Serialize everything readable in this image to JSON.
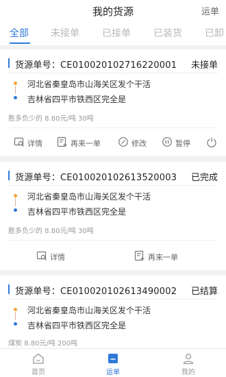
{
  "header": {
    "title": "我的货源",
    "right_action": "运单"
  },
  "tabs": [
    {
      "label": "全部",
      "active": true
    },
    {
      "label": "未接单"
    },
    {
      "label": "已接单"
    },
    {
      "label": "已装货"
    },
    {
      "label": "已卸"
    }
  ],
  "cards": [
    {
      "no": "货源单号：CE010020102716220001",
      "status": "未接单",
      "from": "河北省秦皇岛市山海关区发个干活",
      "to": "吉林省四平市铁西区完全是",
      "meta": "胜多负少的  8.80元/吨  30吨",
      "actions": [
        "详情",
        "再来一单",
        "修改",
        "暂停"
      ]
    },
    {
      "no": "货源单号：CE010020102613520003",
      "status": "已完成",
      "from": "河北省秦皇岛市山海关区发个干活",
      "to": "吉林省四平市铁西区完全是",
      "meta": "胜多负少的  8.80元/吨  30吨",
      "actions": [
        "详情",
        "再来一单"
      ]
    },
    {
      "no": "货源单号：CE010020102613490002",
      "status": "已结算",
      "from": "河北省秦皇岛市山海关区发个干活",
      "to": "吉林省四平市铁西区完全是",
      "meta": "煤炭  8.80元/吨  200吨"
    }
  ],
  "bottom_nav": [
    {
      "label": "首页",
      "icon": "home-icon"
    },
    {
      "label": "运单",
      "icon": "waybill-icon",
      "active": true
    },
    {
      "label": "我的",
      "icon": "profile-icon"
    }
  ],
  "colors": {
    "accent": "#2f79d8",
    "origin_dot": "#f2a33a"
  }
}
